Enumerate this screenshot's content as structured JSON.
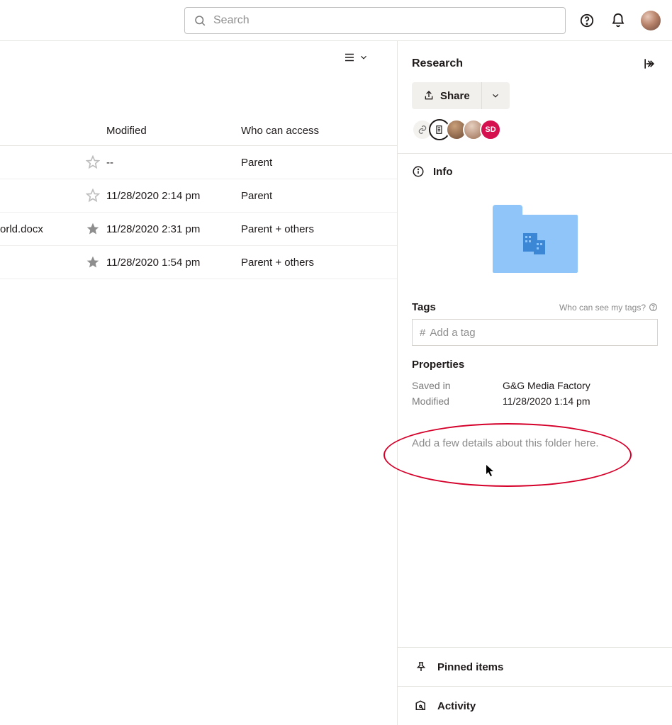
{
  "search": {
    "placeholder": "Search"
  },
  "list": {
    "columns": {
      "modified": "Modified",
      "access": "Who can access"
    },
    "rows": [
      {
        "name": "",
        "starred": false,
        "modified": "--",
        "access": "Parent"
      },
      {
        "name": "",
        "starred": false,
        "modified": "11/28/2020 2:14 pm",
        "access": "Parent"
      },
      {
        "name": "orld.docx",
        "starred": true,
        "modified": "11/28/2020 2:31 pm",
        "access": "Parent + others"
      },
      {
        "name": "",
        "starred": true,
        "modified": "11/28/2020 1:54 pm",
        "access": "Parent + others"
      }
    ]
  },
  "panel": {
    "title": "Research",
    "share_label": "Share",
    "info_label": "Info",
    "tags_label": "Tags",
    "tags_hint": "Who can see my tags?",
    "tag_placeholder": "Add a tag",
    "properties_label": "Properties",
    "properties": {
      "saved_in_label": "Saved in",
      "saved_in_value": "G&G Media Factory",
      "modified_label": "Modified",
      "modified_value": "11/28/2020 1:14 pm"
    },
    "details_placeholder": "Add a few details about this folder here.",
    "pinned_label": "Pinned items",
    "activity_label": "Activity",
    "collaborators": {
      "badge": "SD"
    }
  }
}
